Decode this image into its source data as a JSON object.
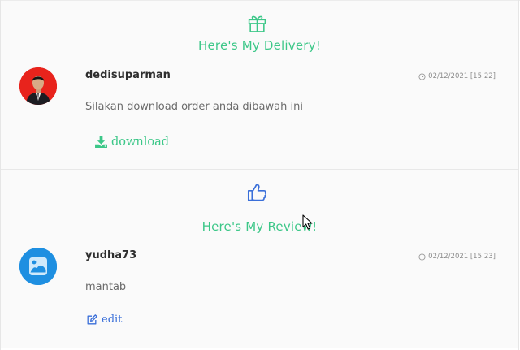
{
  "delivery": {
    "icon": "gift-icon",
    "title": "Here's My Delivery!",
    "username": "dedisuparman",
    "timestamp": "02/12/2021 [15:22]",
    "message": "Silakan download order anda dibawah ini",
    "action_label": "download",
    "action_icon": "download-icon"
  },
  "review": {
    "icon": "thumbs-up-icon",
    "title": "Here's My Review!",
    "username": "yudha73",
    "timestamp": "02/12/2021 [15:23]",
    "message": "mantab",
    "action_label": "edit",
    "action_icon": "edit-icon"
  },
  "colors": {
    "accent_green": "#3cc788",
    "link_blue": "#3a6fd9",
    "delivery_avatar_bg": "#e8231c",
    "review_avatar_bg": "#1e8fe1"
  }
}
